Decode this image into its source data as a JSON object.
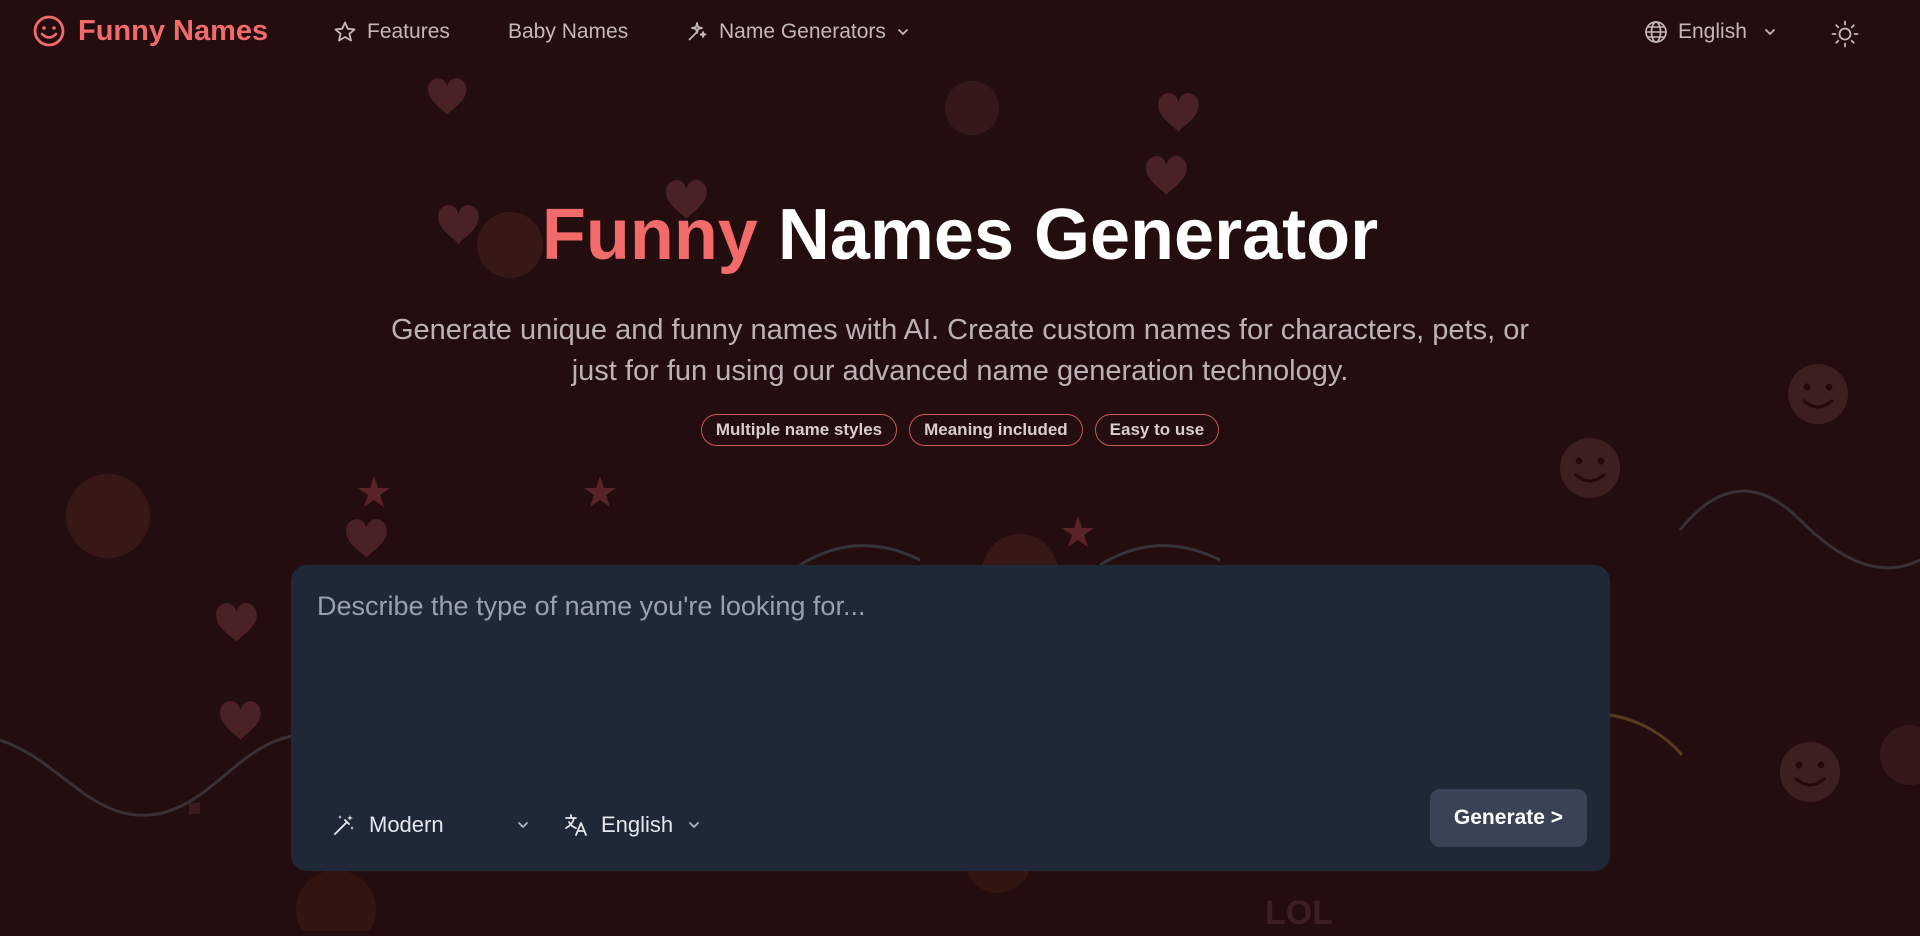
{
  "header": {
    "logo_text": "Funny Names",
    "nav": [
      {
        "label": "Features",
        "icon": "star-icon"
      },
      {
        "label": "Baby Names"
      },
      {
        "label": "Name Generators",
        "icon": "sparkle-icon",
        "has_dropdown": true
      }
    ],
    "language": "English",
    "theme_toggle_icon": "sun-icon"
  },
  "hero": {
    "title_accent": "Funny",
    "title_rest": "Names Generator",
    "subtitle": "Generate unique and funny names with AI. Create custom names for characters, pets, or just for fun using our advanced name generation technology.",
    "features": [
      "Multiple name styles",
      "Meaning included",
      "Easy to use"
    ]
  },
  "generator": {
    "placeholder": "Describe the type of name you're looking for...",
    "style": "Modern",
    "language": "English",
    "generate_label": "Generate >"
  },
  "background": {
    "decor_text": "LOL"
  },
  "colors": {
    "background": "#230d0f",
    "accent": "#f26a6a",
    "panel": "#1f2837",
    "button": "#394355"
  }
}
